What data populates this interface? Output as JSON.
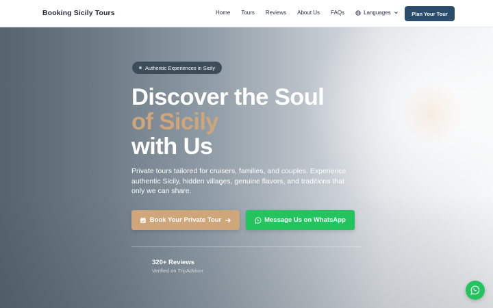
{
  "brand": "Booking Sicily Tours",
  "nav": {
    "links": [
      "Home",
      "Tours",
      "Reviews",
      "About Us",
      "FAQs"
    ],
    "languages_label": "Languages",
    "cta_label": "Plan Your Tour"
  },
  "hero": {
    "badge": "Authentic Experiences in Sicily",
    "headline_line1": "Discover the Soul",
    "headline_line2": "of Sicily",
    "headline_line3": "with Us",
    "subtitle": "Private tours tailored for cruisers, families, and couples. Experience authentic Sicily, hidden villages, genuine flavors, and traditions that only we can share.",
    "book_label": "Book Your Private Tour",
    "whatsapp_label": "Message Us on WhatsApp",
    "reviews_count": "320+ Reviews",
    "reviews_source": "Verified on TripAdvisor"
  },
  "colors": {
    "accent_gold": "#cfa57a",
    "whatsapp_green": "#23c45e",
    "nav_button": "#2a4d6e"
  },
  "icons": {
    "language": "globe-icon",
    "chevron": "chevron-down-icon",
    "book": "calendar-check-icon",
    "arrow": "arrow-right-icon",
    "whatsapp": "whatsapp-icon"
  }
}
